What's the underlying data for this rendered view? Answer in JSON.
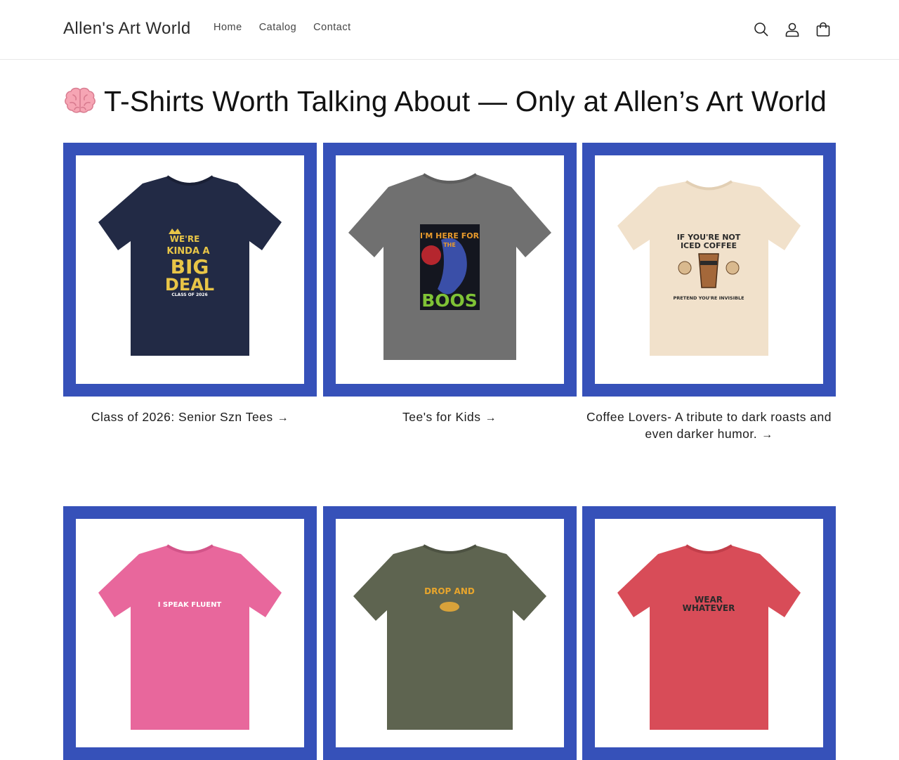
{
  "header": {
    "logo": "Allen's Art World",
    "nav": [
      {
        "label": "Home"
      },
      {
        "label": "Catalog"
      },
      {
        "label": "Contact"
      }
    ],
    "icons": [
      "search-icon",
      "account-icon",
      "cart-icon"
    ]
  },
  "main": {
    "title": "T-Shirts Worth Talking About — Only at Allen’s Art World",
    "title_icon": "brain-emoji-icon"
  },
  "collections": [
    {
      "title": "Class of 2026: Senior Szn Tees",
      "shirt_color": "#222a45",
      "design_lines": [
        "WE'RE",
        "KINDA A",
        "BIG",
        "DEAL",
        "CLASS OF 2026"
      ]
    },
    {
      "title": "Tee's for Kids",
      "shirt_color": "#707070",
      "design_lines": [
        "I'M HERE FOR",
        "THE",
        "BOOS"
      ]
    },
    {
      "title": "Coffee Lovers- A tribute to dark roasts and even darker humor.",
      "shirt_color": "#f1e1cb",
      "design_lines": [
        "IF YOU'RE NOT",
        "ICED COFFEE",
        "PRETEND YOU'RE INVISIBLE"
      ]
    },
    {
      "title": "",
      "shirt_color": "#e8679c",
      "design_lines": [
        "I SPEAK FLUENT"
      ]
    },
    {
      "title": "",
      "shirt_color": "#5e6450",
      "design_lines": [
        "DROP AND"
      ]
    },
    {
      "title": "",
      "shirt_color": "#d84c58",
      "design_lines": [
        "WEAR",
        "WHATEVER"
      ]
    }
  ],
  "colors": {
    "card_border": "#3651b9",
    "text": "#121212"
  },
  "arrow": "→"
}
